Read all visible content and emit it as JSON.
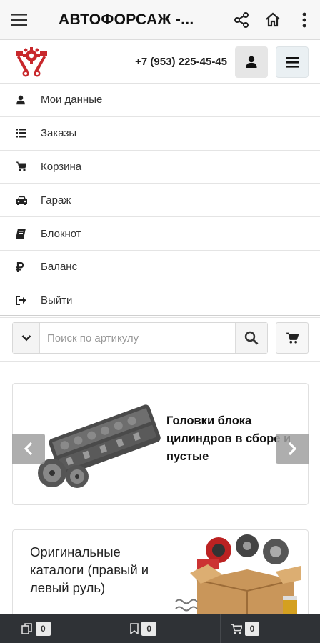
{
  "appbar": {
    "title": "АВТОФОРСАЖ -...",
    "menu_icon": "hamburger-icon",
    "share_icon": "share-icon",
    "home_icon": "home-icon",
    "more_icon": "more-vert-icon"
  },
  "site_header": {
    "logo_icon": "gear-pistons-logo",
    "phone": "+7 (953) 225-45-45",
    "user_icon": "user-icon",
    "burger_icon": "hamburger-icon"
  },
  "menu": {
    "items": [
      {
        "label": "Мои данные",
        "icon": "user-icon"
      },
      {
        "label": "Заказы",
        "icon": "list-icon"
      },
      {
        "label": "Корзина",
        "icon": "cart-icon"
      },
      {
        "label": "Гараж",
        "icon": "car-icon"
      },
      {
        "label": "Блокнот",
        "icon": "notebook-icon"
      },
      {
        "label": "Баланс",
        "icon": "ruble-icon"
      },
      {
        "label": "Выйти",
        "icon": "sign-out-icon"
      }
    ]
  },
  "search": {
    "placeholder": "Поиск по артикулу",
    "dropdown_icon": "chevron-down-icon",
    "search_icon": "search-icon",
    "cart_icon": "cart-icon"
  },
  "slider": {
    "caption": "Головки блока цилиндров в сборе и пустые",
    "image": "cylinder-head-photo"
  },
  "catalog_card": {
    "text": "Оригинальные каталоги (правый и левый руль)",
    "image": "parts-box-photo"
  },
  "bottom_bar": {
    "items": [
      {
        "icon": "copy-icon",
        "count": "0"
      },
      {
        "icon": "bookmark-icon",
        "count": "0"
      },
      {
        "icon": "cart-icon",
        "count": "0"
      }
    ]
  },
  "colors": {
    "accent": "#c8282c",
    "bottom_bar": "#2f3236"
  }
}
